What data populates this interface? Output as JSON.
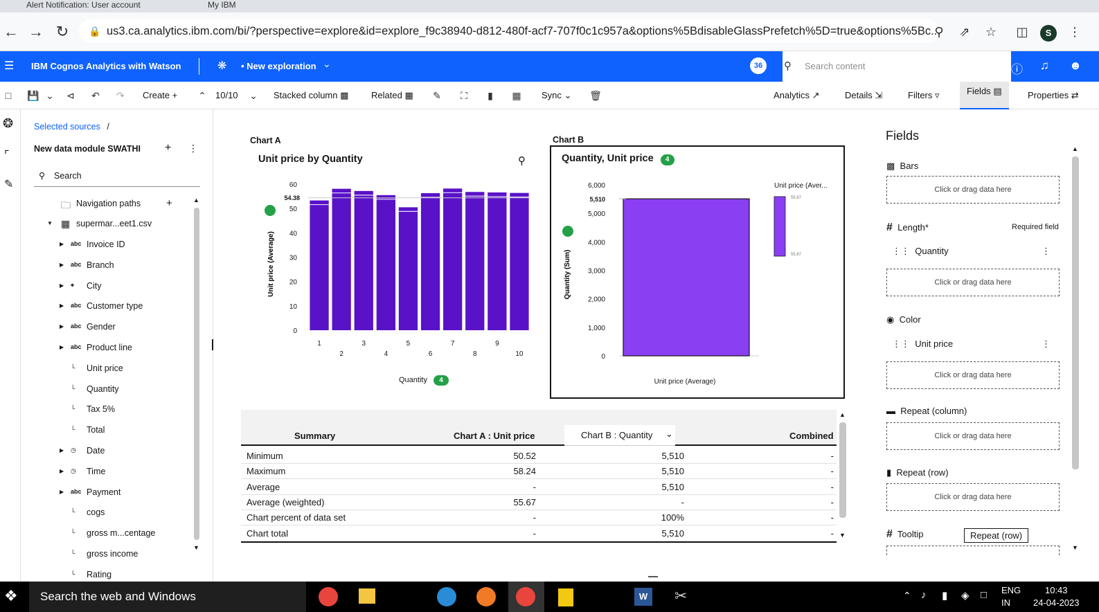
{
  "browser": {
    "tabs": [
      "Alert Notification: User account",
      "My IBM",
      "",
      "",
      ""
    ],
    "url": "us3.ca.analytics.ibm.com/bi/?perspective=explore&id=explore_f9c38940-d812-480f-acf7-707f0c1c957a&options%5BdisableGlassPrefetch%5D=true&options%5Bc...",
    "profile_letter": "S"
  },
  "header": {
    "brand": "IBM Cognos Analytics with Watson",
    "exploration": "• New exploration",
    "search_placeholder": "Search content",
    "badge": "36"
  },
  "toolbar": {
    "create": "Create",
    "count": "10/10",
    "chart_type": "Stacked column",
    "related": "Related",
    "sync": "Sync",
    "analytics": "Analytics",
    "details": "Details",
    "filters": "Filters",
    "fields": "Fields",
    "properties": "Properties"
  },
  "sources": {
    "breadcrumb": "Selected sources",
    "breadcrumb_sep": "/",
    "module": "New data module SWATHI",
    "search": "Search",
    "nav_paths": "Navigation paths",
    "table": "supermar...eet1.csv",
    "items": [
      {
        "label": "Invoice ID",
        "icon": "abc",
        "arrow": true
      },
      {
        "label": "Branch",
        "icon": "abc",
        "arrow": true
      },
      {
        "label": "City",
        "icon": "⌖",
        "arrow": true
      },
      {
        "label": "Customer type",
        "icon": "abc",
        "arrow": true
      },
      {
        "label": "Gender",
        "icon": "abc",
        "arrow": true
      },
      {
        "label": "Product line",
        "icon": "abc",
        "arrow": true
      },
      {
        "label": "Unit price",
        "icon": "└",
        "arrow": false
      },
      {
        "label": "Quantity",
        "icon": "└",
        "arrow": false
      },
      {
        "label": "Tax 5%",
        "icon": "└",
        "arrow": false
      },
      {
        "label": "Total",
        "icon": "└",
        "arrow": false
      },
      {
        "label": "Date",
        "icon": "◷",
        "arrow": true
      },
      {
        "label": "Time",
        "icon": "◷",
        "arrow": true
      },
      {
        "label": "Payment",
        "icon": "abc",
        "arrow": true
      },
      {
        "label": "cogs",
        "icon": "└",
        "arrow": false
      },
      {
        "label": "gross m...centage",
        "icon": "└",
        "arrow": false
      },
      {
        "label": "gross income",
        "icon": "└",
        "arrow": false
      },
      {
        "label": "Rating",
        "icon": "└",
        "arrow": false
      }
    ]
  },
  "chart_data": [
    {
      "type": "bar",
      "label": "Chart A",
      "title": "Unit price by Quantity",
      "xlabel": "Quantity",
      "xlabel_badge": "4",
      "ylabel": "Unit price (Average)",
      "categories": [
        "1",
        "2",
        "3",
        "4",
        "5",
        "6",
        "7",
        "8",
        "9",
        "10"
      ],
      "values": [
        53.3,
        58.1,
        57.2,
        55.5,
        50.5,
        56.3,
        58.2,
        56.8,
        56.6,
        56.4
      ],
      "ylim": [
        0,
        60
      ],
      "yticks": [
        0,
        10,
        20,
        30,
        40,
        50,
        60
      ],
      "reference": {
        "value": 54.38,
        "label": "54.38"
      },
      "color": "#5a12c8"
    },
    {
      "type": "bar",
      "label": "Chart B",
      "title": "Quantity, Unit price",
      "title_badge": "4",
      "xlabel": "Unit price (Average)",
      "ylabel": "Quantity (Sum)",
      "categories": [
        "Unit price (Average)"
      ],
      "values": [
        5510
      ],
      "ylim": [
        0,
        6000
      ],
      "yticks": [
        0,
        1000,
        2000,
        3000,
        4000,
        5000,
        6000
      ],
      "reference": {
        "value": 5510,
        "label": "5,510"
      },
      "legend": {
        "title": "Unit price (Aver...",
        "max": "55.67",
        "min": "55.67"
      },
      "color": "#8a3ff2"
    }
  ],
  "summary": {
    "headers": [
      "Summary",
      "Chart A : Unit price",
      "Chart B : Quantity",
      "Combined"
    ],
    "rows": [
      {
        "label": "Minimum",
        "a": "50.52",
        "b": "5,510",
        "c": "-"
      },
      {
        "label": "Maximum",
        "a": "58.24",
        "b": "5,510",
        "c": "-"
      },
      {
        "label": "Average",
        "a": "-",
        "b": "5,510",
        "c": "-"
      },
      {
        "label": "Average (weighted)",
        "a": "55.67",
        "b": "-",
        "c": "-"
      },
      {
        "label": "Chart percent of data set",
        "a": "-",
        "b": "100%",
        "c": "-"
      },
      {
        "label": "Chart total",
        "a": "-",
        "b": "5,510",
        "c": "-"
      }
    ]
  },
  "fields": {
    "title": "Fields",
    "bars": "Bars",
    "length": "Length*",
    "required": "Required field",
    "length_field": "Quantity",
    "color": "Color",
    "color_field": "Unit price",
    "repeat_col": "Repeat (column)",
    "repeat_row": "Repeat (row)",
    "tooltip": "Tooltip",
    "drop_hint": "Click or drag data here",
    "tooltip_popup": "Repeat (row)"
  },
  "taskbar": {
    "search": "Search the web and Windows",
    "lang": "ENG",
    "lang2": "IN",
    "time": "10:43",
    "date": "24-04-2023"
  }
}
